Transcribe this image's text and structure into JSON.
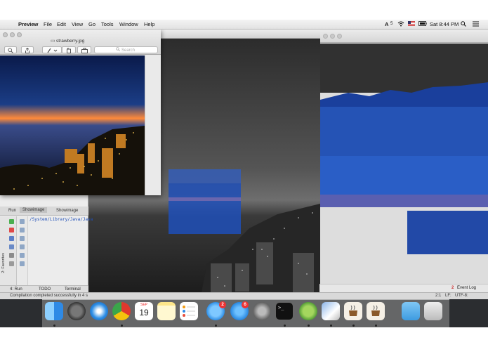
{
  "menubar": {
    "app_name": "Preview",
    "menus": [
      "File",
      "Edit",
      "View",
      "Go",
      "Tools",
      "Window",
      "Help"
    ],
    "adobe_count": "5",
    "datetime": "Sat 8:44 PM"
  },
  "preview": {
    "title": "strawberry.jpg",
    "search_placeholder": "Search"
  },
  "ide": {
    "label_run": "Run",
    "tab_active": "Showimage",
    "tab_other": "Showimage",
    "console_line": "/System/Library/Java/Java",
    "favorites_label": "2: Favorites",
    "bottom_run": "4: Run",
    "bottom_todo": "TODO",
    "bottom_terminal": "Terminal",
    "event_log": "Event Log",
    "event_log_num": "2",
    "status_message": "Compilation completed successfully in 4 s",
    "caret_pos": "2:1",
    "line_sep": "LF:",
    "encoding": "UTF-8:"
  },
  "dock": {
    "calendar_day": "19",
    "calendar_month": "SEP",
    "messages_badge": "2",
    "appstore_badge": "6"
  },
  "colors": {
    "night_sky": "#0d1a3d",
    "sunset": "#ff7a2a",
    "blue_region": "#1a3f9c"
  }
}
